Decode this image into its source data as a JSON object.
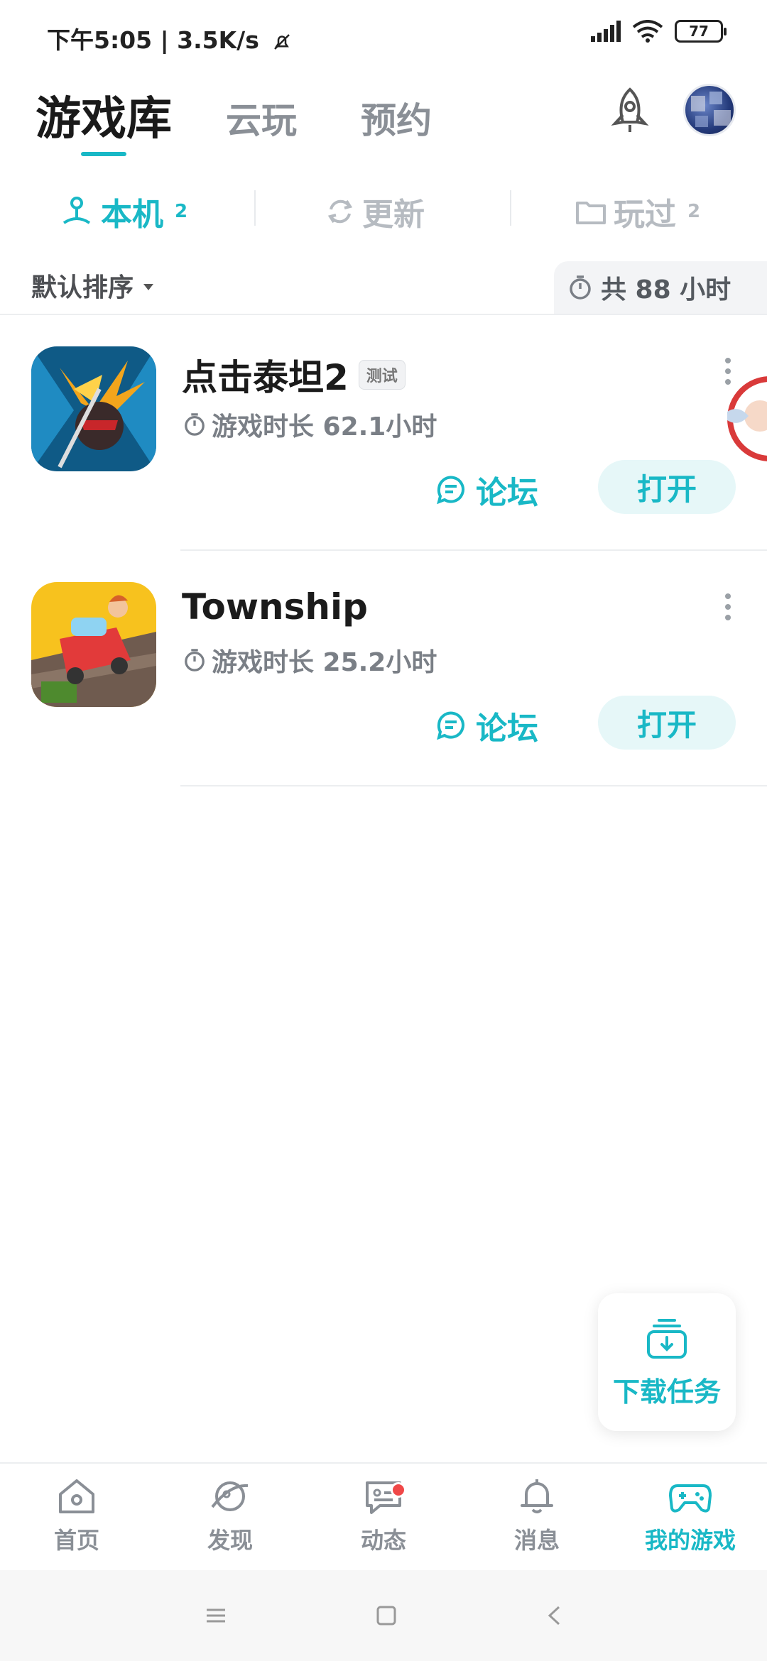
{
  "status_bar": {
    "time_speed": "下午5:05 | 3.5K/s",
    "battery": "77"
  },
  "top_tabs": {
    "library": "游戏库",
    "cloud": "云玩",
    "reserve": "预约"
  },
  "sub_tabs": [
    {
      "label": "本机",
      "count": "2"
    },
    {
      "label": "更新",
      "count": ""
    },
    {
      "label": "玩过",
      "count": "2"
    }
  ],
  "sort": {
    "label": "默认排序",
    "total_time": "共 88 小时"
  },
  "games": [
    {
      "title": "点击泰坦2",
      "badge": "测试",
      "playtime": "游戏时长 62.1小时",
      "forum_label": "论坛",
      "open_label": "打开"
    },
    {
      "title": "Township",
      "badge": "",
      "playtime": "游戏时长 25.2小时",
      "forum_label": "论坛",
      "open_label": "打开"
    }
  ],
  "download_task": {
    "label": "下载任务"
  },
  "bottom_nav": [
    {
      "label": "首页",
      "icon": "home-icon"
    },
    {
      "label": "发现",
      "icon": "planet-icon"
    },
    {
      "label": "动态",
      "icon": "feed-icon"
    },
    {
      "label": "消息",
      "icon": "bell-icon"
    },
    {
      "label": "我的游戏",
      "icon": "gamepad-icon"
    }
  ],
  "colors": {
    "accent": "#19b8c6",
    "muted": "#8a8f96",
    "alert": "#f04848"
  }
}
